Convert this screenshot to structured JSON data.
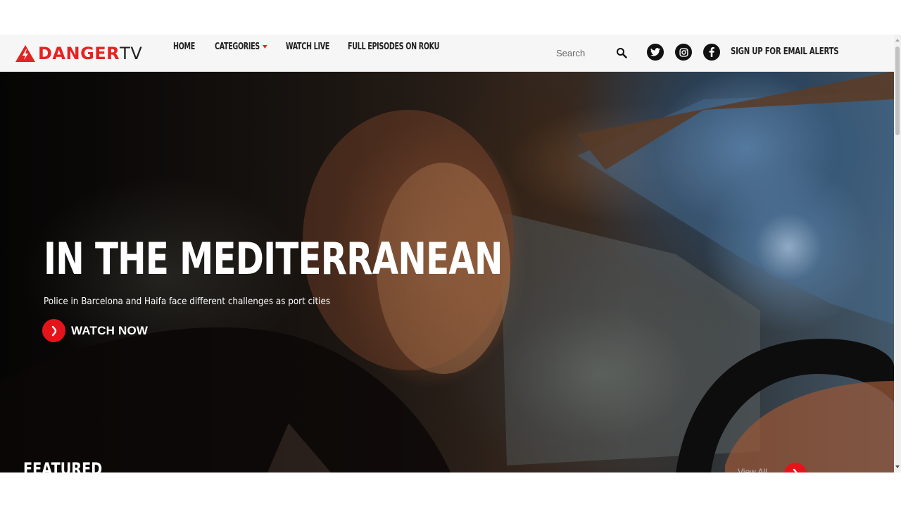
{
  "brand": {
    "name_main": "DANGER",
    "name_suffix": "TV",
    "colors": {
      "brand_red": "#e52321",
      "dark": "#222222",
      "nav_bg": "#f6f6f6"
    }
  },
  "nav": {
    "items": [
      {
        "label": "HOME"
      },
      {
        "label": "CATEGORIES",
        "has_dropdown": true
      },
      {
        "label": "WATCH LIVE"
      },
      {
        "label": "FULL EPISODES ON ROKU"
      }
    ]
  },
  "search": {
    "placeholder": "Search",
    "value": "",
    "icon": "search-icon"
  },
  "social": [
    {
      "network": "twitter",
      "icon": "twitter-icon"
    },
    {
      "network": "instagram",
      "icon": "instagram-icon"
    },
    {
      "network": "facebook",
      "icon": "facebook-icon"
    }
  ],
  "email_alerts": {
    "label": "SIGN UP FOR EMAIL ALERTS"
  },
  "hero": {
    "title": "IN THE MEDITERRANEAN",
    "subtitle": "Police in Barcelona and Haifa face different challenges as port cities",
    "cta_label": "WATCH NOW",
    "cta_icon": "chevron-right-icon"
  },
  "featured": {
    "label": "FEATURED",
    "view_all_label": "View All",
    "view_all_icon": "chevron-right-icon"
  }
}
